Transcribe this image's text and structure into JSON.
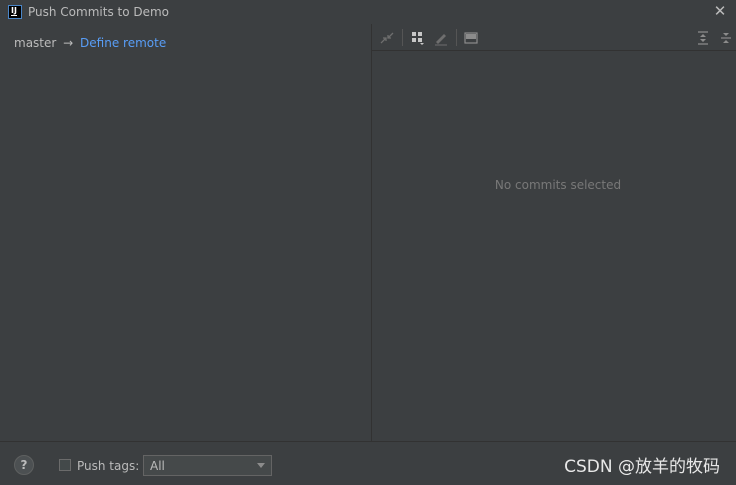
{
  "window": {
    "title": "Push Commits to Demo"
  },
  "left": {
    "branch": "master",
    "arrow": "→",
    "remote_link": "Define remote"
  },
  "right": {
    "empty_message": "No commits selected"
  },
  "bottom": {
    "help": "?",
    "push_tags_label": "Push tags:",
    "push_tags_value": "All"
  },
  "watermark": "CSDN @放羊的牧码",
  "colors": {
    "background": "#3c3f41",
    "link": "#589df6",
    "text": "#bbbbbb",
    "muted": "#787878"
  }
}
